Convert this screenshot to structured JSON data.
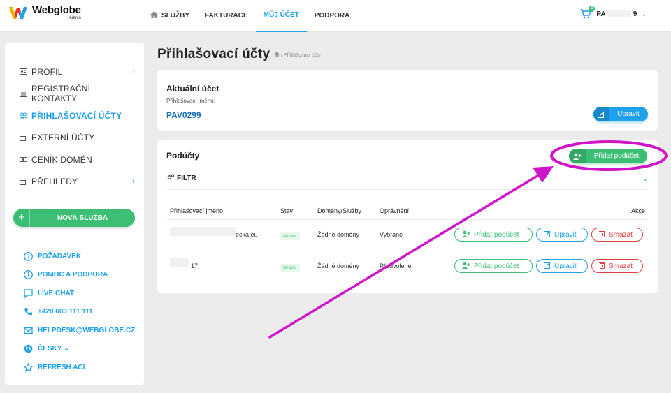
{
  "brand": {
    "name": "Webglobe",
    "sub": "Admin",
    "colors": {
      "accent": "#1ea0ea",
      "green": "#3cbf74",
      "red": "#e04040",
      "annotation": "#d015c9"
    }
  },
  "nav": [
    {
      "label": "SLUŽBY",
      "icon": "home-icon"
    },
    {
      "label": "FAKTURACE"
    },
    {
      "label": "MŮJ ÚČET",
      "active": true
    },
    {
      "label": "PODPORA"
    }
  ],
  "user": {
    "cart_count": "0",
    "name_start": "PA",
    "name_end": "9"
  },
  "sidebar": {
    "menu": [
      {
        "label": "PROFIL",
        "icon": "id-card-icon",
        "arrow": "›"
      },
      {
        "label": "REGISTRAČNÍ KONTAKTY",
        "icon": "contacts-icon"
      },
      {
        "label": "PŘIHLAŠOVACÍ ÚČTY",
        "icon": "users-icon",
        "active": true
      },
      {
        "label": "EXTERNÍ ÚČTY",
        "icon": "window-icon"
      },
      {
        "label": "CENÍK DOMÉN",
        "icon": "price-icon"
      },
      {
        "label": "PŘEHLEDY",
        "icon": "window-icon",
        "arrow": "›"
      }
    ],
    "new_service": {
      "plus": "+",
      "label": "NOVÁ SLUŽBA"
    },
    "support": [
      {
        "label": "POŽADAVEK",
        "icon": "question-circle-icon"
      },
      {
        "label": "POMOC A PODPORA",
        "icon": "info-circle-icon"
      },
      {
        "label": "LIVE CHAT",
        "icon": "chat-icon"
      },
      {
        "label": "+420 603 111 111",
        "icon": "phone-icon"
      },
      {
        "label": "HELPDESK@WEBGLOBE.CZ",
        "icon": "envelope-icon"
      },
      {
        "label": "ČESKY ⌄",
        "icon": "globe-icon"
      },
      {
        "label": "REFRESH ACL",
        "icon": "star-icon"
      }
    ]
  },
  "page": {
    "title": "Přihlašovací účty",
    "breadcrumb": "/ Přihlašovací účty"
  },
  "current_account": {
    "heading": "Aktuální účet",
    "login_label": "Přihlašovací jméno:",
    "login_value": "PAV0299",
    "edit_label": "Upravit"
  },
  "subaccounts": {
    "heading": "Podúčty",
    "add_label": "Přidat podúčet",
    "filter_label": "FILTR",
    "columns": [
      "Přihlašovací jméno",
      "Stav",
      "Domény/Služby",
      "Oprávnění",
      "Akce"
    ],
    "rows": [
      {
        "login": "ecka.eu",
        "status": "Aktivní",
        "domains": "Žádné domény",
        "permissions": "Vybrané"
      },
      {
        "login": "17",
        "status": "Aktivní",
        "domains": "Žádné domény",
        "permissions": "Předvolené"
      }
    ],
    "row_actions": {
      "add": "Přidat podúčet",
      "edit": "Upravit",
      "delete": "Smazat"
    }
  }
}
